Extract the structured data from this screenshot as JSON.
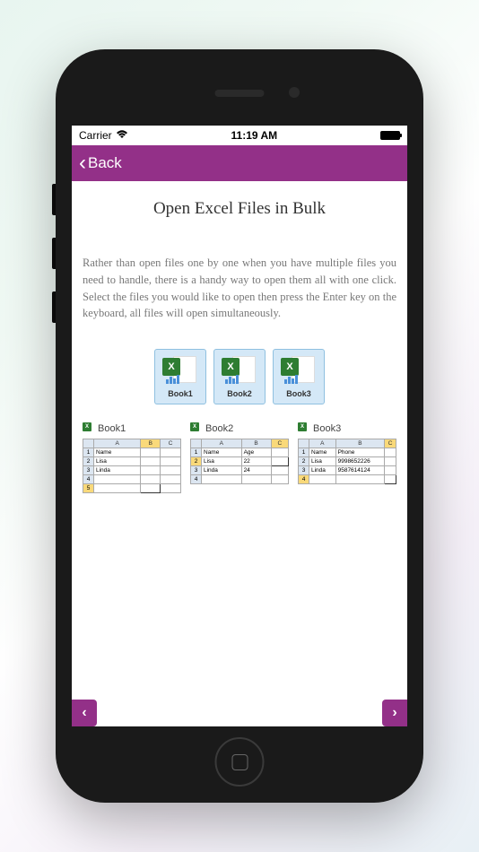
{
  "statusBar": {
    "carrier": "Carrier",
    "time": "11:19 AM"
  },
  "navBar": {
    "backLabel": "Back"
  },
  "page": {
    "title": "Open Excel Files in Bulk",
    "description": "Rather than open files one by one when you have multiple files you need to handle, there is a handy way to open them all with one click. Select the files you would like to open then press the Enter key on the keyboard, all files will open simultaneously."
  },
  "fileIcons": [
    {
      "name": "Book1"
    },
    {
      "name": "Book2"
    },
    {
      "name": "Book3"
    }
  ],
  "sheets": {
    "book1": {
      "title": "Book1",
      "cols": [
        "A",
        "B",
        "C"
      ],
      "rows": [
        [
          "1",
          "Name",
          "",
          ""
        ],
        [
          "2",
          "Lisa",
          "",
          ""
        ],
        [
          "3",
          "Linda",
          "",
          ""
        ],
        [
          "4",
          "",
          "",
          ""
        ],
        [
          "5",
          "",
          "",
          ""
        ]
      ]
    },
    "book2": {
      "title": "Book2",
      "cols": [
        "A",
        "B",
        "C"
      ],
      "rows": [
        [
          "1",
          "Name",
          "Age",
          ""
        ],
        [
          "2",
          "Lisa",
          "22",
          ""
        ],
        [
          "3",
          "Linda",
          "24",
          ""
        ],
        [
          "4",
          "",
          "",
          ""
        ]
      ]
    },
    "book3": {
      "title": "Book3",
      "cols": [
        "A",
        "B",
        "C"
      ],
      "rows": [
        [
          "1",
          "Name",
          "Phone",
          ""
        ],
        [
          "2",
          "Lisa",
          "9998652226",
          ""
        ],
        [
          "3",
          "Linda",
          "9587614124",
          ""
        ],
        [
          "4",
          "",
          "",
          ""
        ]
      ]
    }
  }
}
